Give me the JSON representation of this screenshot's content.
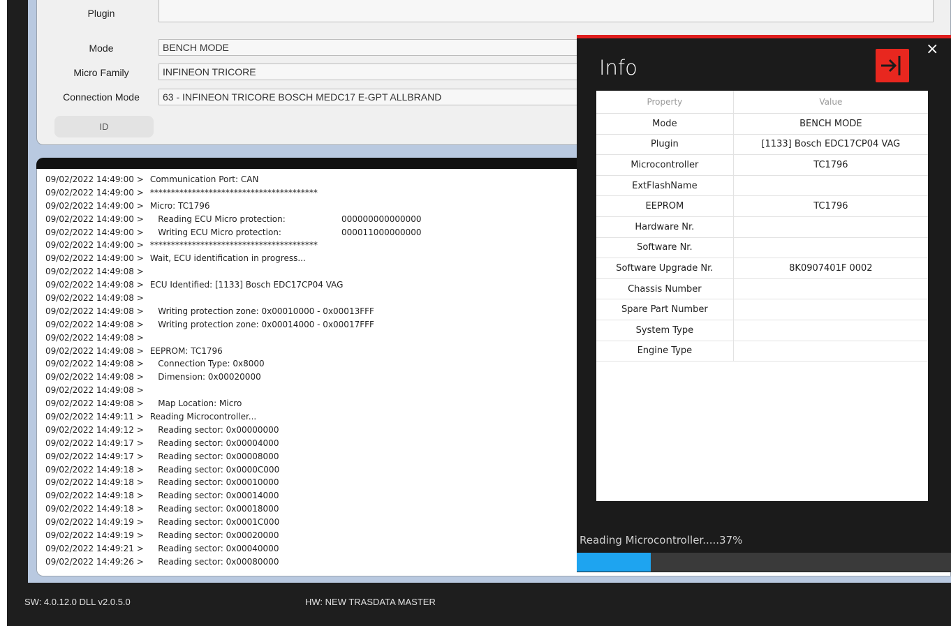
{
  "top_form": {
    "plugin_label": "Plugin",
    "plugin_value": "",
    "mode_label": "Mode",
    "mode_value": "BENCH MODE",
    "micro_family_label": "Micro Family",
    "micro_family_value": "INFINEON TRICORE",
    "connection_mode_label": "Connection Mode",
    "connection_mode_value": "63 - INFINEON TRICORE BOSCH MEDC17 E-GPT ALLBRAND",
    "id_button": "ID"
  },
  "log": {
    "lines": [
      {
        "ts": "09/02/2022 14:49:00 >",
        "msg": " Communication Port: CAN",
        "val": ""
      },
      {
        "ts": "09/02/2022 14:49:00 >",
        "msg": " ****************************************",
        "val": ""
      },
      {
        "ts": "09/02/2022 14:49:00 >",
        "msg": " Micro: TC1796",
        "val": ""
      },
      {
        "ts": "09/02/2022 14:49:00 >",
        "msg": "    Reading ECU Micro protection:",
        "val": "000000000000000"
      },
      {
        "ts": "09/02/2022 14:49:00 >",
        "msg": "    Writing ECU Micro protection:",
        "val": "000011000000000"
      },
      {
        "ts": "09/02/2022 14:49:00 >",
        "msg": " ****************************************",
        "val": ""
      },
      {
        "ts": "09/02/2022 14:49:00 >",
        "msg": " Wait, ECU identification in progress...",
        "val": ""
      },
      {
        "ts": "09/02/2022 14:49:08 >",
        "msg": "",
        "val": ""
      },
      {
        "ts": "09/02/2022 14:49:08 >",
        "msg": " ECU Identified: [1133] Bosch EDC17CP04 VAG",
        "val": ""
      },
      {
        "ts": "09/02/2022 14:49:08 >",
        "msg": "",
        "val": ""
      },
      {
        "ts": "09/02/2022 14:49:08 >",
        "msg": "    Writing protection zone: 0x00010000 - 0x00013FFF",
        "val": ""
      },
      {
        "ts": "09/02/2022 14:49:08 >",
        "msg": "    Writing protection zone: 0x00014000 - 0x00017FFF",
        "val": ""
      },
      {
        "ts": "09/02/2022 14:49:08 >",
        "msg": "",
        "val": ""
      },
      {
        "ts": "09/02/2022 14:49:08 >",
        "msg": " EEPROM: TC1796",
        "val": ""
      },
      {
        "ts": "09/02/2022 14:49:08 >",
        "msg": "    Connection Type: 0x8000",
        "val": ""
      },
      {
        "ts": "09/02/2022 14:49:08 >",
        "msg": "    Dimension: 0x00020000",
        "val": ""
      },
      {
        "ts": "09/02/2022 14:49:08 >",
        "msg": "",
        "val": ""
      },
      {
        "ts": "09/02/2022 14:49:08 >",
        "msg": "    Map Location: Micro",
        "val": ""
      },
      {
        "ts": "09/02/2022 14:49:11 >",
        "msg": " Reading Microcontroller...",
        "val": ""
      },
      {
        "ts": "09/02/2022 14:49:12 >",
        "msg": "    Reading sector: 0x00000000",
        "val": ""
      },
      {
        "ts": "09/02/2022 14:49:17 >",
        "msg": "    Reading sector: 0x00004000",
        "val": ""
      },
      {
        "ts": "09/02/2022 14:49:17 >",
        "msg": "    Reading sector: 0x00008000",
        "val": ""
      },
      {
        "ts": "09/02/2022 14:49:18 >",
        "msg": "    Reading sector: 0x0000C000",
        "val": ""
      },
      {
        "ts": "09/02/2022 14:49:18 >",
        "msg": "    Reading sector: 0x00010000",
        "val": ""
      },
      {
        "ts": "09/02/2022 14:49:18 >",
        "msg": "    Reading sector: 0x00014000",
        "val": ""
      },
      {
        "ts": "09/02/2022 14:49:18 >",
        "msg": "    Reading sector: 0x00018000",
        "val": ""
      },
      {
        "ts": "09/02/2022 14:49:19 >",
        "msg": "    Reading sector: 0x0001C000",
        "val": ""
      },
      {
        "ts": "09/02/2022 14:49:19 >",
        "msg": "    Reading sector: 0x00020000",
        "val": ""
      },
      {
        "ts": "09/02/2022 14:49:21 >",
        "msg": "    Reading sector: 0x00040000",
        "val": ""
      },
      {
        "ts": "09/02/2022 14:49:26 >",
        "msg": "    Reading sector: 0x00080000",
        "val": ""
      }
    ]
  },
  "status_bar": {
    "sw": "SW: 4.0.12.0 DLL v2.0.5.0",
    "hw": "HW: NEW TRASDATA MASTER"
  },
  "info_dialog": {
    "title": "Info",
    "close_glyph": "×",
    "exit_icon": "exit-arrow-icon",
    "columns": [
      "Property",
      "Value"
    ],
    "rows": [
      [
        "Mode",
        "BENCH MODE"
      ],
      [
        "Plugin",
        "[1133] Bosch EDC17CP04 VAG"
      ],
      [
        "Microcontroller",
        "TC1796"
      ],
      [
        "ExtFlashName",
        ""
      ],
      [
        "EEPROM",
        "TC1796"
      ],
      [
        "Hardware Nr.",
        ""
      ],
      [
        "Software Nr.",
        ""
      ],
      [
        "Software Upgrade Nr.",
        "8K0907401F  0002"
      ],
      [
        "Chassis Number",
        ""
      ],
      [
        "Spare Part Number",
        ""
      ],
      [
        "System Type",
        ""
      ],
      [
        "Engine Type",
        ""
      ]
    ],
    "progress_text": "Reading Microcontroller.....37%",
    "progress_value": 0.37,
    "colors": {
      "accent_red": "#e01e1e",
      "progress_blue": "#1ea4f0"
    }
  }
}
